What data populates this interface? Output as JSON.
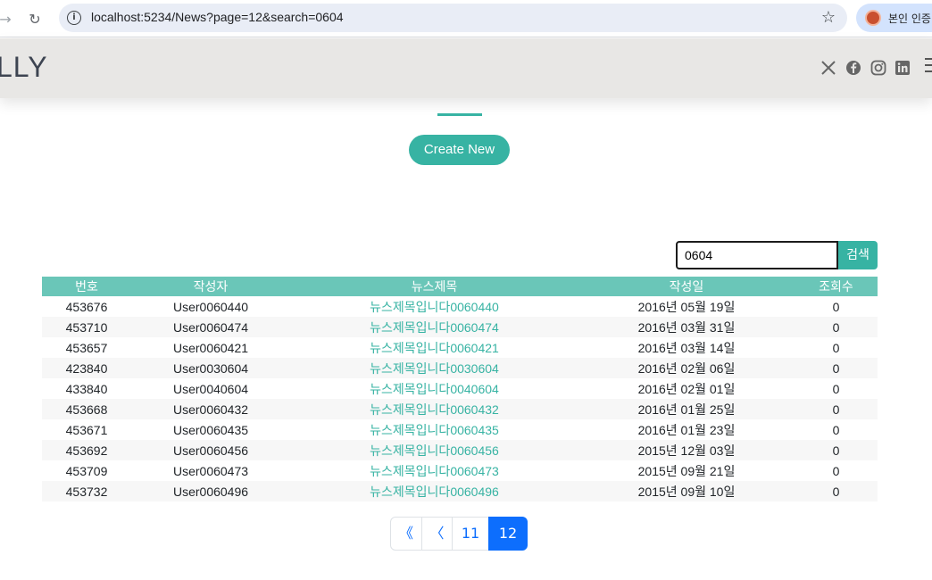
{
  "browser": {
    "back_label": "→",
    "reload_label": "↻",
    "url": "localhost:5234/News?page=12&search=0604",
    "star_label": "☆",
    "profile_label": "본인 인증"
  },
  "header": {
    "brand": "LLY"
  },
  "main": {
    "create_label": "Create New",
    "search": {
      "value": "0604",
      "button_label": "검색"
    },
    "table": {
      "headers": [
        "번호",
        "작성자",
        "뉴스제목",
        "작성일",
        "조회수"
      ],
      "rows": [
        {
          "id": "453676",
          "writer": "User0060440",
          "title": "뉴스제목입니다0060440",
          "date": "2016년 05월 19일",
          "views": "0"
        },
        {
          "id": "453710",
          "writer": "User0060474",
          "title": "뉴스제목입니다0060474",
          "date": "2016년 03월 31일",
          "views": "0"
        },
        {
          "id": "453657",
          "writer": "User0060421",
          "title": "뉴스제목입니다0060421",
          "date": "2016년 03월 14일",
          "views": "0"
        },
        {
          "id": "423840",
          "writer": "User0030604",
          "title": "뉴스제목입니다0030604",
          "date": "2016년 02월 06일",
          "views": "0"
        },
        {
          "id": "433840",
          "writer": "User0040604",
          "title": "뉴스제목입니다0040604",
          "date": "2016년 02월 01일",
          "views": "0"
        },
        {
          "id": "453668",
          "writer": "User0060432",
          "title": "뉴스제목입니다0060432",
          "date": "2016년 01월 25일",
          "views": "0"
        },
        {
          "id": "453671",
          "writer": "User0060435",
          "title": "뉴스제목입니다0060435",
          "date": "2016년 01월 23일",
          "views": "0"
        },
        {
          "id": "453692",
          "writer": "User0060456",
          "title": "뉴스제목입니다0060456",
          "date": "2015년 12월 03일",
          "views": "0"
        },
        {
          "id": "453709",
          "writer": "User0060473",
          "title": "뉴스제목입니다0060473",
          "date": "2015년 09월 21일",
          "views": "0"
        },
        {
          "id": "453732",
          "writer": "User0060496",
          "title": "뉴스제목입니다0060496",
          "date": "2015년 09월 10일",
          "views": "0"
        }
      ]
    },
    "pagination": {
      "first_label": "《",
      "prev_label": "〈",
      "pages": [
        "11",
        "12"
      ],
      "current": "12"
    }
  },
  "colors": {
    "accent": "#37b3a3",
    "table_header": "#6ac6b8",
    "pagination_active": "#0d6efd"
  }
}
